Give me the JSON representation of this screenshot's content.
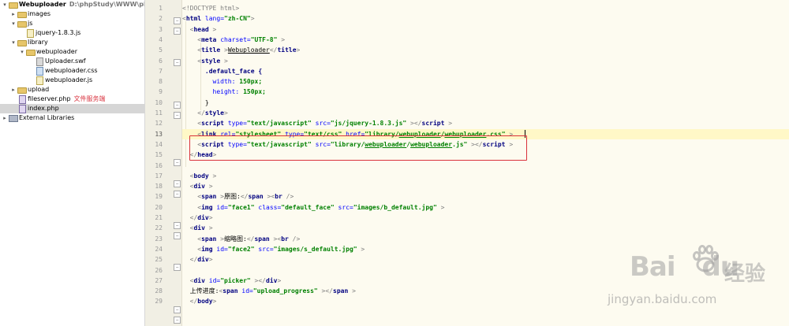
{
  "project_tree": {
    "root": {
      "name": "Webuploader",
      "path": "D:\\phpStudy\\WWW\\phpStudy\\We"
    },
    "items": [
      {
        "label": "images",
        "type": "folder"
      },
      {
        "label": "js",
        "type": "folder"
      },
      {
        "label": "jquery-1.8.3.js",
        "type": "js"
      },
      {
        "label": "library",
        "type": "folder"
      },
      {
        "label": "webuploader",
        "type": "folder"
      },
      {
        "label": "Uploader.swf",
        "type": "swf"
      },
      {
        "label": "webuploader.css",
        "type": "css"
      },
      {
        "label": "webuploader.js",
        "type": "js"
      },
      {
        "label": "upload",
        "type": "folder"
      },
      {
        "label": "fileserver.php",
        "type": "php",
        "note": "文件服务端"
      },
      {
        "label": "index.php",
        "type": "php",
        "selected": true
      },
      {
        "label": "External Libraries",
        "type": "library"
      }
    ]
  },
  "editor": {
    "current_line": 13,
    "line_numbers": [
      "1",
      "2",
      "3",
      "4",
      "5",
      "6",
      "7",
      "8",
      "9",
      "10",
      "11",
      "12",
      "13",
      "14",
      "15",
      "16",
      "17",
      "18",
      "19",
      "20",
      "21",
      "22",
      "23",
      "24",
      "25",
      "26",
      "27",
      "28",
      "29"
    ],
    "code": {
      "l1": "<!DOCTYPE html>",
      "l2_tag": "html",
      "l2_attr": "lang=",
      "l2_val": "\"zh-CN\"",
      "l3_tag": "head",
      "l4_tag": "meta",
      "l4_attr": "charset=",
      "l4_val": "\"UTF-8\"",
      "l5_tag": "title",
      "l5_text": "Webuploader",
      "l6_tag": "style",
      "l7_sel": ".default_face {",
      "l8_prop": "width:",
      "l8_val": " 150px;",
      "l9_prop": "height:",
      "l9_val": " 150px;",
      "l10": "}",
      "l11_tag": "style",
      "l12_tag": "script",
      "l12_a1": "type=",
      "l12_v1": "\"text/javascript\"",
      "l12_a2": "src=",
      "l12_v2": "\"js/jquery-1.8.3.js\"",
      "l13_tag": "link",
      "l13_a1": "rel=",
      "l13_v1": "\"stylesheet\"",
      "l13_a2": "type=",
      "l13_v2": "\"text/css\"",
      "l13_a3": "href=",
      "l13_v3a": "\"library/",
      "l13_v3b": "webuploader",
      "l13_v3c": "/",
      "l13_v3d": "webuploader",
      "l13_v3e": ".css\"",
      "l14_tag": "script",
      "l14_a1": "type=",
      "l14_v1": "\"text/javascript\"",
      "l14_a2": "src=",
      "l14_v2a": "\"library/",
      "l14_v2b": "webuploader",
      "l14_v2c": "/",
      "l14_v2d": "webuploader",
      "l14_v2e": ".js\"",
      "l15_tag": "head",
      "l17_tag": "body",
      "l18_tag": "div",
      "l19_tag": "span",
      "l19_text": "原图:",
      "l19_br": "br",
      "l20_tag": "img",
      "l20_a1": "id=",
      "l20_v1": "\"face1\"",
      "l20_a2": "class=",
      "l20_v2": "\"default_face\"",
      "l20_a3": "src=",
      "l20_v3": "\"images/b_default.jpg\"",
      "l21_tag": "div",
      "l22_tag": "div",
      "l23_tag": "span",
      "l23_text": "缩略图:",
      "l23_br": "br",
      "l24_tag": "img",
      "l24_a1": "id=",
      "l24_v1": "\"face2\"",
      "l24_a2": "src=",
      "l24_v2": "\"images/s_default.jpg\"",
      "l25_tag": "div",
      "l27_tag": "div",
      "l27_a1": "id=",
      "l27_v1": "\"picker\"",
      "l28_text": "上传进度:",
      "l28_tag": "span",
      "l28_a1": "id=",
      "l28_v1": "\"upload_progress\"",
      "l29_tag": "body"
    }
  },
  "watermark": {
    "brand": "Bai",
    "brand2": "du",
    "cn": "经验",
    "url": "jingyan.baidu.com"
  },
  "colors": {
    "tag": "#000080",
    "attr": "#0000ff",
    "value": "#008000",
    "highlight_box": "#d9323b",
    "current_line": "#fff8c7"
  }
}
